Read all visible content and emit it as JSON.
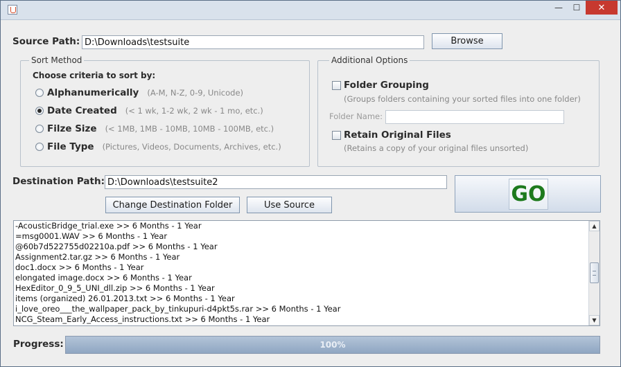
{
  "window": {
    "minimize": "—",
    "maximize": "☐",
    "close": "✕"
  },
  "source": {
    "label": "Source Path:",
    "value": "D:\\Downloads\\testsuite",
    "browse": "Browse"
  },
  "sort_method": {
    "title": "Sort Method",
    "criteria_label": "Choose criteria to sort by:",
    "options": [
      {
        "label": "Alphanumerically",
        "hint": "(A-M, N-Z, 0-9, Unicode)",
        "checked": false
      },
      {
        "label": "Date Created",
        "hint": "(< 1 wk, 1-2 wk, 2 wk - 1 mo, etc.)",
        "checked": true
      },
      {
        "label": "Filze Size",
        "hint": "(< 1MB, 1MB - 10MB, 10MB - 100MB, etc.)",
        "checked": false
      },
      {
        "label": "File Type",
        "hint": "(Pictures, Videos, Documents, Archives, etc.)",
        "checked": false
      }
    ]
  },
  "additional": {
    "title": "Additional Options",
    "folder_grouping": {
      "label": "Folder Grouping",
      "hint": "(Groups folders containing your sorted files into one folder)",
      "checked": false
    },
    "folder_name_label": "Folder Name:",
    "folder_name_value": "",
    "retain": {
      "label": "Retain Original Files",
      "hint": "(Retains a copy of your original files unsorted)",
      "checked": false
    }
  },
  "destination": {
    "label": "Destination Path:",
    "value": "D:\\Downloads\\testsuite2",
    "change_button": "Change Destination Folder",
    "use_source_button": "Use Source"
  },
  "go_label": "GO",
  "log": [
    "-AcousticBridge_trial.exe >> 6 Months - 1 Year",
    "=msg0001.WAV >> 6 Months - 1 Year",
    "@60b7d522755d02210a.pdf >> 6 Months - 1 Year",
    "Assignment2.tar.gz >> 6 Months - 1 Year",
    "doc1.docx >> 6 Months - 1 Year",
    "elongated image.docx >> 6 Months - 1 Year",
    "HexEditor_0_9_5_UNI_dll.zip >> 6 Months - 1 Year",
    "items (organized) 26.01.2013.txt >> 6 Months - 1 Year",
    "i_love_oreo___the_wallpaper_pack_by_tinkupuri-d4pkt5s.rar >> 6 Months - 1 Year",
    "NCG_Steam_Early_Access_instructions.txt >> 6 Months - 1 Year"
  ],
  "progress": {
    "label": "Progress:",
    "percent": 100,
    "text": "100%"
  }
}
